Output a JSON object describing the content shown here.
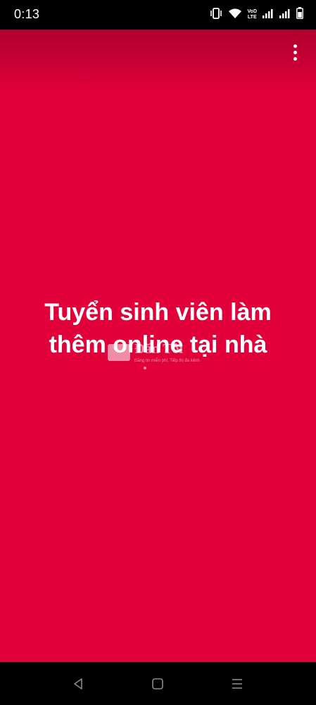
{
  "status_bar": {
    "time": "0:13",
    "volte_top": "VoD",
    "volte_bottom": "LTE",
    "icons": [
      "vibrate-icon",
      "wifi-icon",
      "volte-icon",
      "signal-icon",
      "signal-icon-2",
      "battery-icon"
    ]
  },
  "content": {
    "background_color": "#e1003a",
    "headline_line1": "Tuyển sinh viên làm",
    "headline_line2": "thêm online tại nhà",
    "more_icon": "more-vert-icon"
  },
  "watermark": {
    "title": "Đăn Tôi",
    "subtitle": "Đăng tin miễn phí, Tiếp thị đa kênh"
  },
  "nav_bar": {
    "icons": [
      "back-icon",
      "home-icon",
      "recents-icon"
    ]
  }
}
